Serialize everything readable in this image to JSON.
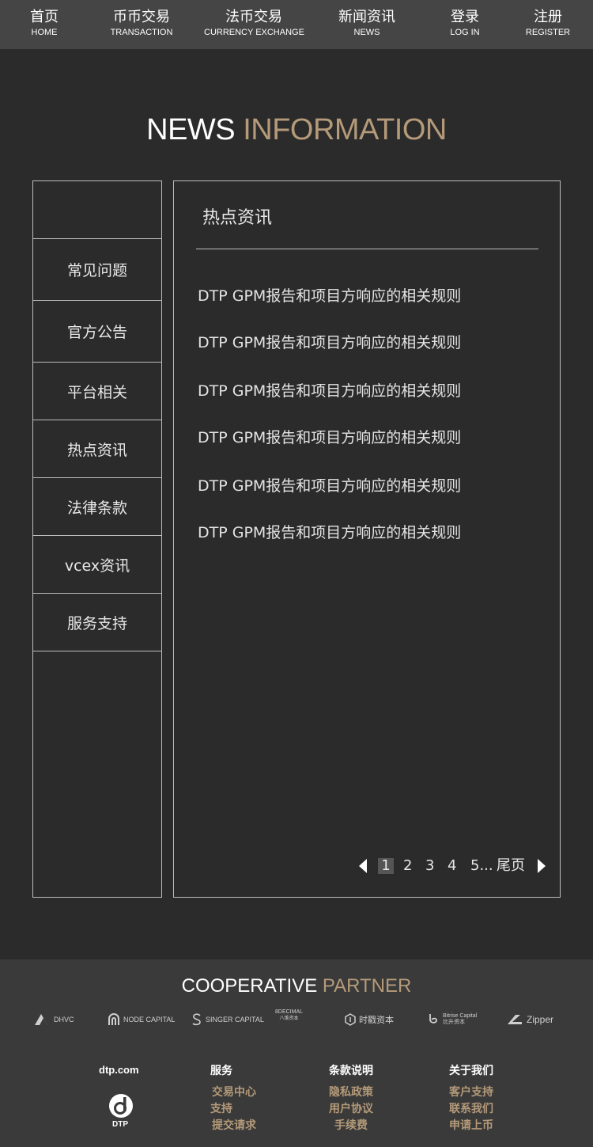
{
  "nav": [
    {
      "zh": "首页",
      "en": "HOME"
    },
    {
      "zh": "币币交易",
      "en": "TRANSACTION"
    },
    {
      "zh": "法币交易",
      "en": "CURRENCY EXCHANGE"
    },
    {
      "zh": "新闻资讯",
      "en": "NEWS"
    },
    {
      "zh": "登录",
      "en": "LOG IN"
    },
    {
      "zh": "注册",
      "en": "REGISTER"
    }
  ],
  "title": {
    "part1": "NEWS",
    "part2": "INFORMATION"
  },
  "sidebar": {
    "items": [
      "常见问题",
      "官方公告",
      "平台相关",
      "热点资讯",
      "法律条款",
      "vcex资讯",
      "服务支持"
    ]
  },
  "panel": {
    "title": "热点资讯",
    "news": [
      "DTP GPM报告和项目方响应的相关规则",
      "DTP GPM报告和项目方响应的相关规则",
      "DTP GPM报告和项目方响应的相关规则",
      "DTP GPM报告和项目方响应的相关规则",
      "DTP GPM报告和项目方响应的相关规则",
      "DTP GPM报告和项目方响应的相关规则"
    ]
  },
  "pager": {
    "pages": [
      "1",
      "2",
      "3",
      "4",
      "5..."
    ],
    "current": "1",
    "last_label": "尾页"
  },
  "partners": {
    "title_part1": "COOPERATIVE",
    "title_part2": "PARTNER",
    "logos": [
      "DHVC",
      "NODE CAPITAL",
      "SINGER CAPITAL",
      "8DECIMAL",
      "八维资本",
      "时戳资本",
      "Bitrise Capital",
      "比升资本",
      "Zipper"
    ]
  },
  "footer": {
    "brand": "dtp.com",
    "brand_sub": "DTP",
    "columns": [
      {
        "head": "服务",
        "links": [
          "交易中心",
          "支持",
          "提交请求"
        ]
      },
      {
        "head": "条款说明",
        "links": [
          "隐私政策",
          "用户协议",
          "手续费"
        ]
      },
      {
        "head": "关于我们",
        "links": [
          "客户支持",
          "联系我们",
          "申请上币"
        ]
      }
    ]
  },
  "colors": {
    "accent": "#b49a79",
    "background": "#2b2b2b",
    "nav": "#454545",
    "footer": "#3a3a3a"
  }
}
